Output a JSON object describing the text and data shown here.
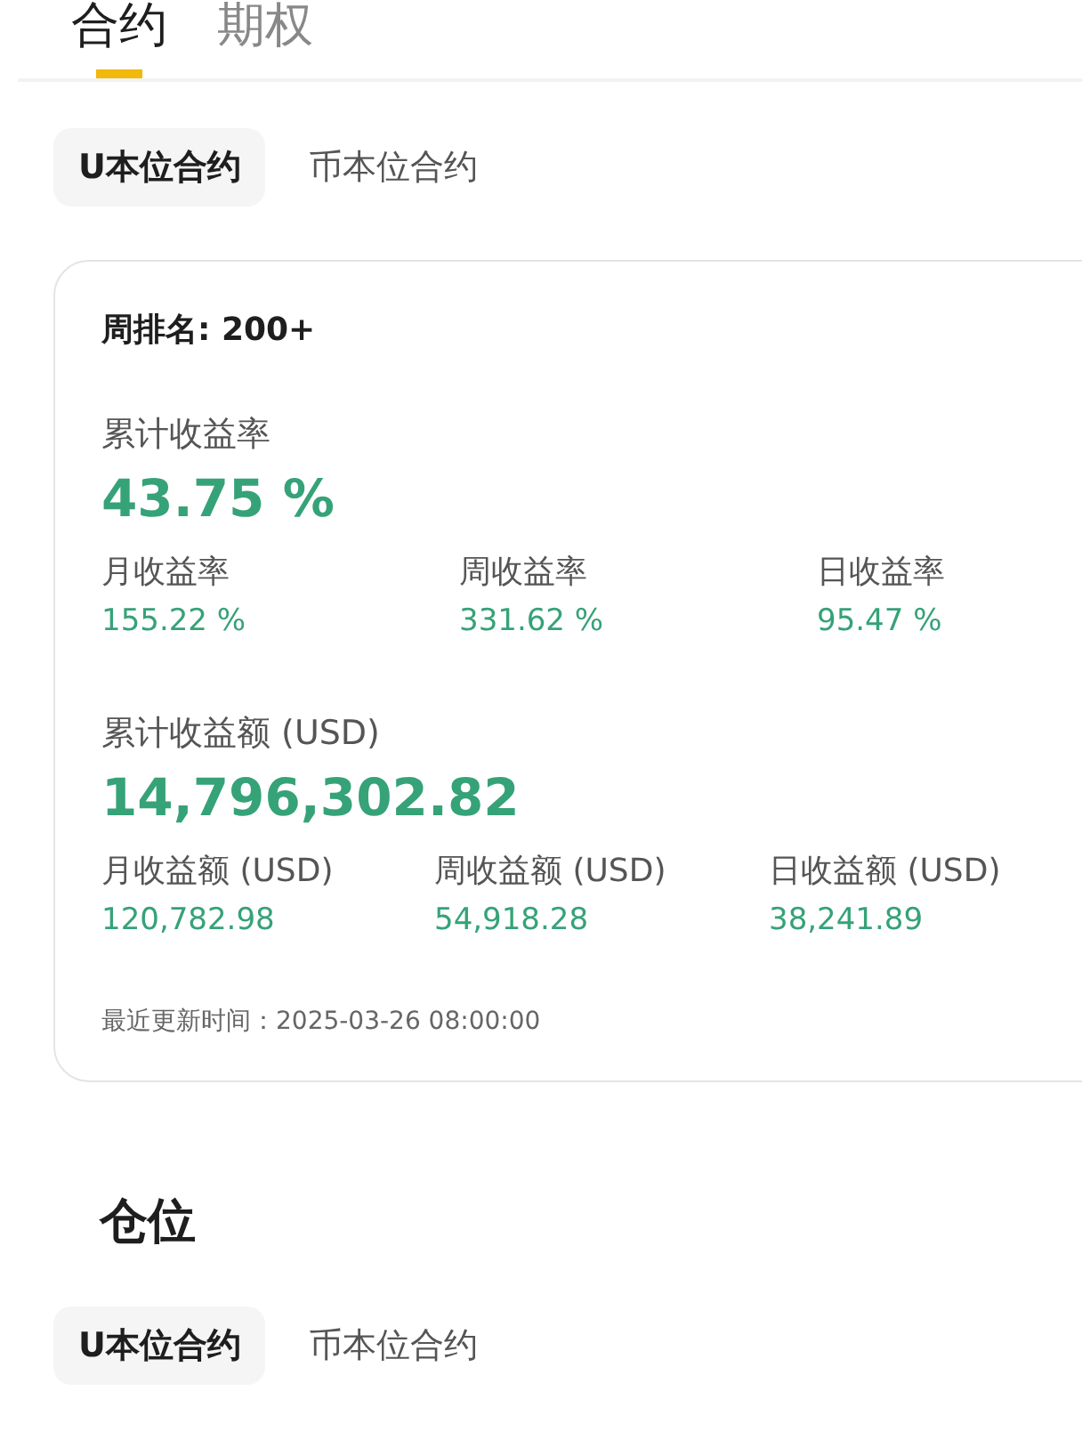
{
  "top_tabs": [
    {
      "label": "合约",
      "selected": true
    },
    {
      "label": "期权",
      "selected": false
    }
  ],
  "contract_tabs": [
    {
      "label": "U本位合约",
      "selected": true
    },
    {
      "label": "币本位合约",
      "selected": false
    }
  ],
  "stats_card": {
    "rank": "周排名: 200+",
    "sections": [
      {
        "label": "累计收益率",
        "value": "43.75 %",
        "periods": [
          {
            "label": "月收益率",
            "value": "155.22 %"
          },
          {
            "label": "周收益率",
            "value": "331.62 %"
          },
          {
            "label": "日收益率",
            "value": "95.47 %"
          }
        ]
      },
      {
        "label": "累计收益额 (USD)",
        "value": "14,796,302.82",
        "periods": [
          {
            "label": "月收益额 (USD)",
            "value": "120,782.98"
          },
          {
            "label": "周收益额 (USD)",
            "value": "54,918.28"
          },
          {
            "label": "日收益额 (USD)",
            "value": "38,241.89"
          }
        ]
      }
    ],
    "updated": "最近更新时间：2025-03-26 08:00:00"
  },
  "positions": {
    "title": "仓位",
    "tabs": [
      {
        "label": "U本位合约",
        "selected": true
      },
      {
        "label": "币本位合约",
        "selected": false
      }
    ]
  }
}
